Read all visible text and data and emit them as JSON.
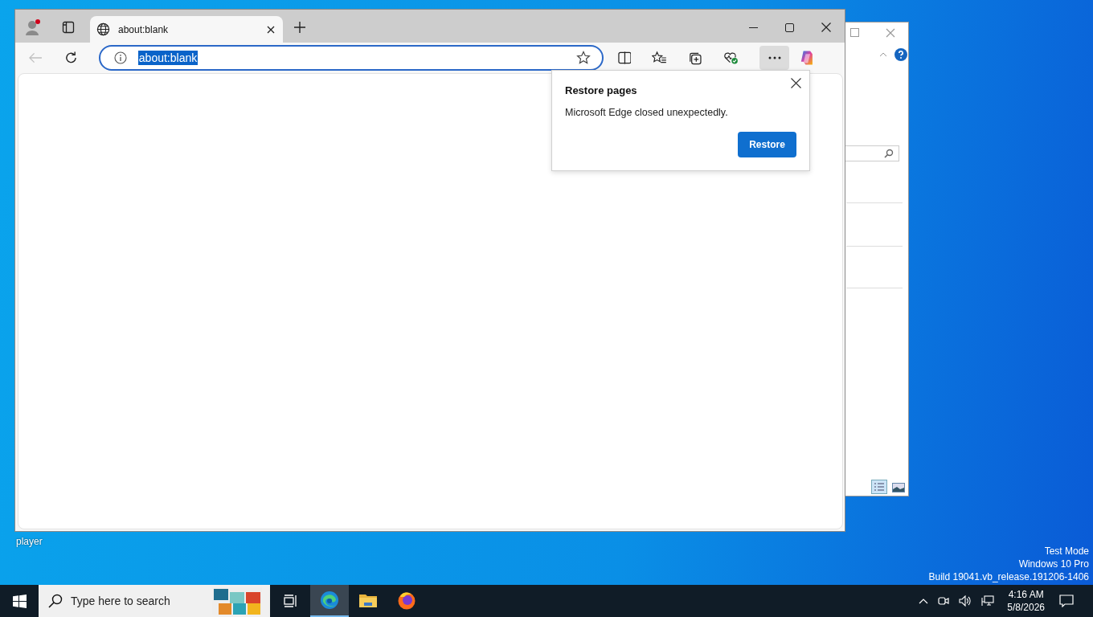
{
  "desktop": {
    "icon_labels": [
      "player"
    ],
    "system_info": [
      "Test Mode",
      "Windows 10 Pro",
      "Build 19041.vb_release.191206-1406"
    ]
  },
  "browser": {
    "tabs": [
      {
        "title": "about:blank",
        "selected": true
      }
    ],
    "address": "about:blank",
    "address_selected": true,
    "back_disabled": true,
    "menu_open": true
  },
  "restore_popup": {
    "title": "Restore pages",
    "message": "Microsoft Edge closed unexpectedly.",
    "button": "Restore"
  },
  "taskbar": {
    "search_placeholder": "Type here to search",
    "apps": [
      {
        "kind": "edge",
        "active": true
      },
      {
        "kind": "folder",
        "active": false
      },
      {
        "kind": "firefox",
        "active": false
      }
    ],
    "time": "4:16 AM",
    "date": "5/8/2026"
  }
}
